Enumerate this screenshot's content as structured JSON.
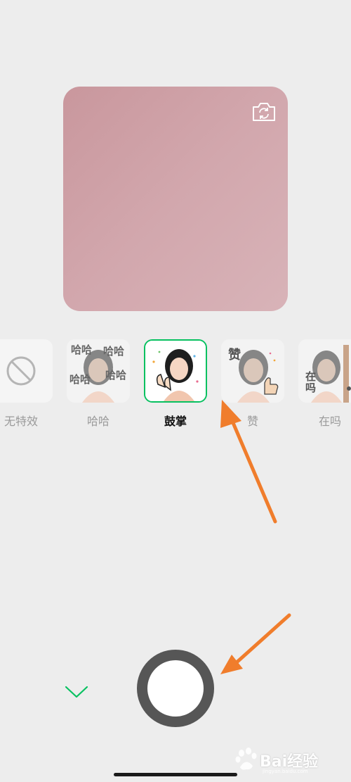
{
  "preview": {
    "flip_icon": "camera-flip-icon"
  },
  "effects": [
    {
      "label": "无特效",
      "icon": "no-effect-icon",
      "selected": false
    },
    {
      "label": "哈哈",
      "icon": "haha-sticker",
      "selected": false,
      "deco": [
        "哈哈",
        "哈哈",
        "哈哈",
        "哈哈"
      ]
    },
    {
      "label": "鼓掌",
      "icon": "clap-sticker",
      "selected": true
    },
    {
      "label": "赞",
      "icon": "thumbs-up-sticker",
      "selected": false,
      "deco": [
        "赞"
      ]
    },
    {
      "label": "在吗",
      "icon": "zaima-sticker",
      "selected": false,
      "deco": [
        "在",
        "吗"
      ]
    }
  ],
  "controls": {
    "collapse_icon": "chevron-down-icon",
    "shutter": "record-button"
  },
  "colors": {
    "background": "#ededed",
    "accent": "#07c160",
    "preview": "#d2a7ad",
    "arrow": "#f07d2c"
  },
  "watermark": {
    "brand": "Bai经验",
    "sub": "jingyan.baidu.com"
  }
}
